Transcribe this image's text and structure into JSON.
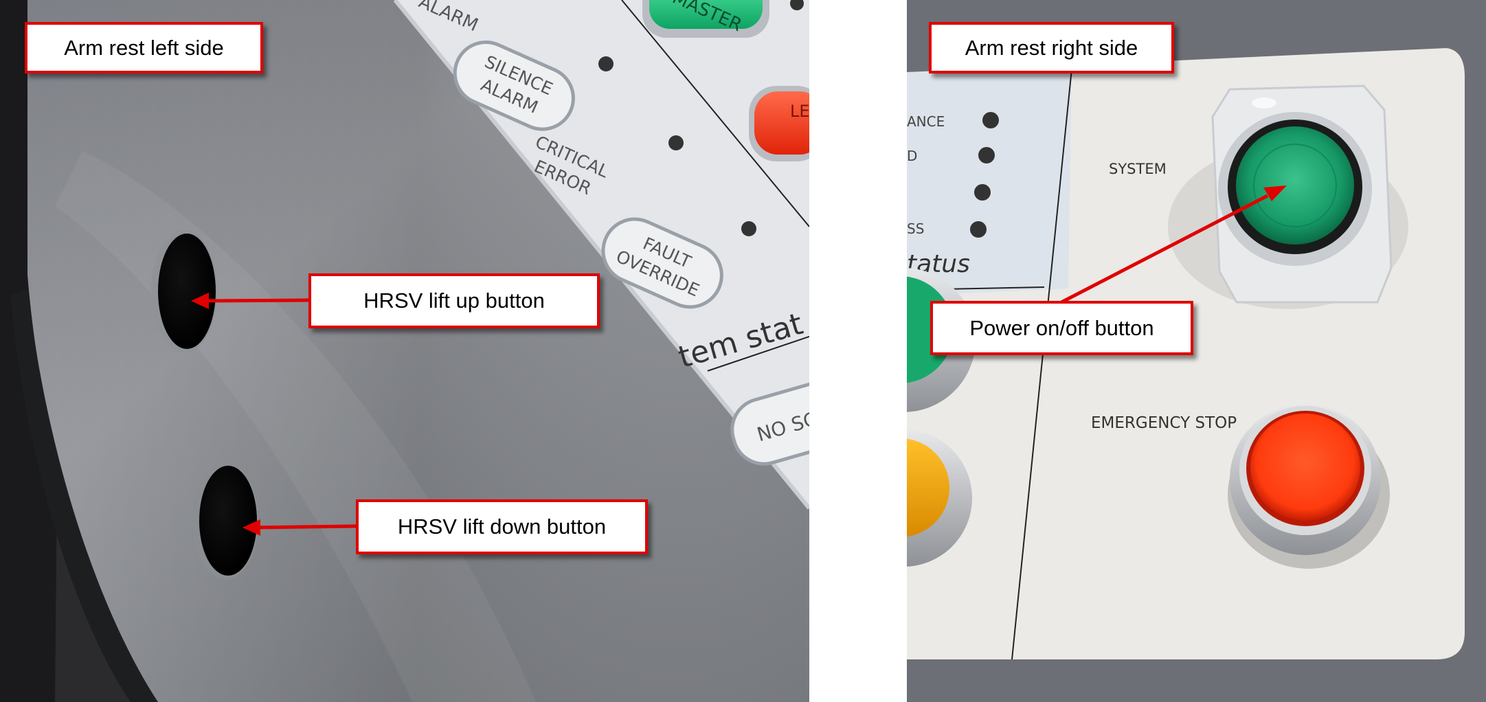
{
  "left_panel": {
    "title": "Arm rest left side",
    "panel_text": {
      "alarm": "ALARM",
      "master": "MASTER",
      "silence_alarm_line1": "SILENCE",
      "silence_alarm_line2": "ALARM",
      "critical_error_line1": "CRITICAL",
      "critical_error_line2": "ERROR",
      "fault_override_line1": "FAULT",
      "fault_override_line2": "OVERRIDE",
      "system_status": "tem stat",
      "no_sc": "NO SC",
      "le": "LE"
    },
    "callouts": {
      "lift_up": "HRSV lift up button",
      "lift_down": "HRSV lift down button"
    }
  },
  "right_panel": {
    "title": "Arm rest right side",
    "panel_text": {
      "ance": "ANCE",
      "d": "D",
      "ss": "SS",
      "status": "tatus",
      "system": "SYSTEM",
      "emergency_stop": "EMERGENCY STOP"
    },
    "callouts": {
      "power": "Power on/off button"
    }
  },
  "colors": {
    "callout_border": "#e00000",
    "arrow": "#e00000",
    "panel_gray": "#8e9196",
    "faceplate": "#e4e6ea",
    "green_button": "#19a86b",
    "red_button": "#ff3a10",
    "amber_button": "#f2a300"
  }
}
